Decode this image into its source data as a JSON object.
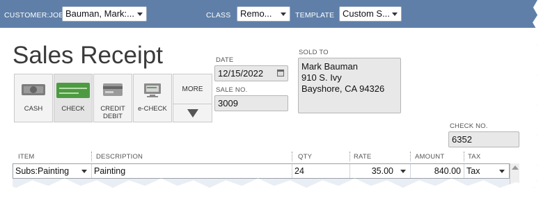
{
  "header": {
    "customer_job_label": "CUSTOMER:JOB",
    "customer_job_value": "Bauman, Mark:...",
    "class_label": "CLASS",
    "class_value": "Remo...",
    "template_label": "TEMPLATE",
    "template_value": "Custom S..."
  },
  "form": {
    "title": "Sales Receipt",
    "date_label": "DATE",
    "date_value": "12/15/2022",
    "sale_no_label": "SALE NO.",
    "sale_no_value": "3009",
    "sold_to_label": "SOLD TO",
    "sold_to_lines": [
      "Mark Bauman",
      "910 S. Ivy",
      "Bayshore, CA  94326"
    ],
    "check_no_label": "CHECK NO.",
    "check_no_value": "6352"
  },
  "payment_methods": [
    {
      "label": "CASH",
      "icon": "cash-icon"
    },
    {
      "label": "CHECK",
      "icon": "check-icon"
    },
    {
      "label_line1": "CREDIT",
      "label_line2": "DEBIT",
      "icon": "credit-card-icon"
    },
    {
      "label": "e-CHECK",
      "icon": "echeck-icon"
    }
  ],
  "more_label": "MORE",
  "grid": {
    "columns": [
      "ITEM",
      "DESCRIPTION",
      "QTY",
      "RATE",
      "AMOUNT",
      "TAX"
    ],
    "rows": [
      {
        "item": "Subs:Painting",
        "description": "Painting",
        "qty": "24",
        "rate": "35.00",
        "amount": "840.00",
        "tax": "Tax"
      }
    ]
  },
  "colors": {
    "header_bg": "#5f7fa8",
    "check_green": "#4e9a43"
  }
}
